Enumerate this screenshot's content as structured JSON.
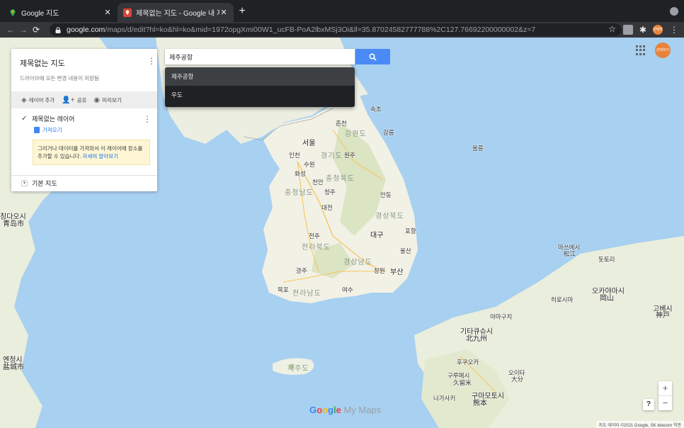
{
  "browser": {
    "tabs": [
      {
        "title": "Google 지도",
        "close": "✕"
      },
      {
        "title": "제목없는 지도 - Google 내 지도",
        "close": "✕"
      }
    ],
    "new_tab": "+",
    "url_host": "google.com",
    "url_path": "/maps/d/edit?hl=ko&hl=ko&mid=1972opgXmi00W1_ucFB-PoA2lbxMSj3Oi&ll=35.87024582777788%2C127.76692200000002&z=7",
    "avatar_text": "선택하기"
  },
  "panel": {
    "title": "제목없는 지도",
    "subtitle": "드라이브에 모든 변경 내용이 저장됨",
    "actions": [
      {
        "icon": "layers-icon",
        "label": "레이어 추가"
      },
      {
        "icon": "share-icon",
        "label": "공유"
      },
      {
        "icon": "eye-icon",
        "label": "미리보기"
      }
    ],
    "layer": {
      "name": "제목없는 레이어",
      "import_label": "가져오기"
    },
    "hint_text": "그리거나 데이터를 가져와서 이 레이어에 장소를 추가할 수 있습니다. ",
    "hint_link": "자세히 알아보기",
    "basemap_label": "기본 지도"
  },
  "search": {
    "value": "제주공항",
    "suggestions": [
      "제주공항",
      "우도"
    ]
  },
  "map": {
    "labels": [
      "서울",
      "인천",
      "춘천",
      "강원도",
      "강릉",
      "속초",
      "수원",
      "경기도",
      "원주",
      "화성",
      "천안",
      "충청북도",
      "청주",
      "충청남도",
      "대전",
      "경상북도",
      "안동",
      "대구",
      "포항",
      "울산",
      "부산",
      "전주",
      "전라북도",
      "광주",
      "전라남도",
      "목포",
      "여수",
      "경상남도",
      "창원",
      "제주도",
      "울릉",
      "칭다오시",
      "青岛市",
      "옌청시",
      "盐城市",
      "마쓰에시",
      "松江",
      "돗토리",
      "오카야마시",
      "岡山",
      "히로시마",
      "고베시",
      "神戸",
      "기타큐슈시",
      "北九州",
      "후쿠오카",
      "구루메시",
      "久留米",
      "구마모토시",
      "熊本",
      "오이타",
      "大分",
      "나가사키",
      "야마구치"
    ],
    "logo_google": "Google",
    "logo_suffix": " My Maps",
    "attribution": "지도 데이터 ©2021 Google, SK telecom   약관",
    "zoom_in": "+",
    "zoom_out": "−",
    "help": "?"
  },
  "colors": {
    "sea": "#a8d0f0",
    "land": "#eef0e6",
    "korea_land": "#f2f1e6",
    "mountain": "#c9d8ab",
    "accent": "#4a8af4",
    "avatar": "#e8833a"
  }
}
